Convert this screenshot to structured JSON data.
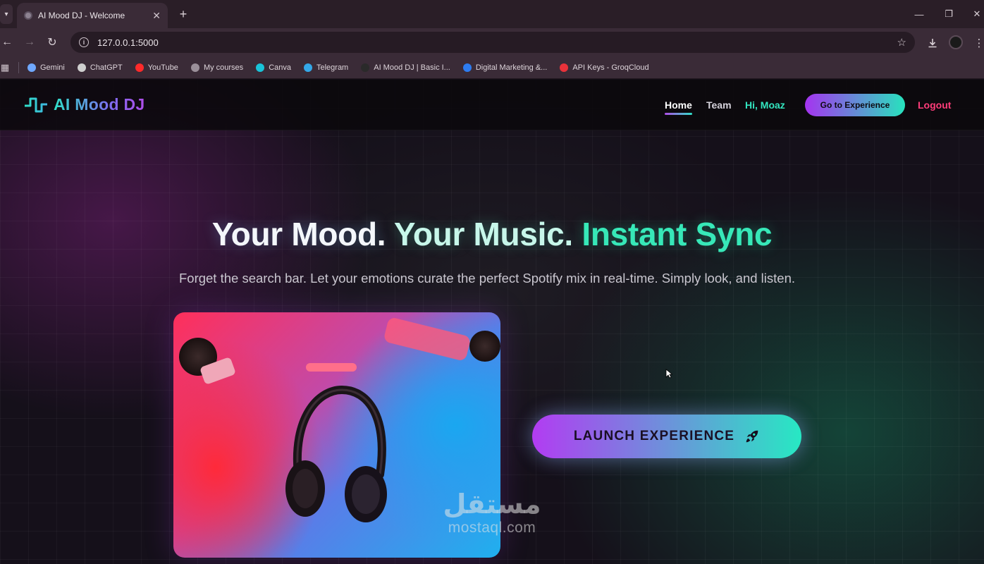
{
  "browser": {
    "tab_title": "AI Mood DJ - Welcome",
    "url": "127.0.0.1:5000",
    "bookmarks": [
      {
        "label": "Gemini",
        "color": "#6fa8ff"
      },
      {
        "label": "ChatGPT",
        "color": "#cfcfcf"
      },
      {
        "label": "YouTube",
        "color": "#ff2a2a"
      },
      {
        "label": "My courses",
        "color": "#9a8f99"
      },
      {
        "label": "Canva",
        "color": "#19c3d8"
      },
      {
        "label": "Telegram",
        "color": "#34a8e8"
      },
      {
        "label": "AI Mood DJ | Basic I...",
        "color": "#2a2a2a"
      },
      {
        "label": "Digital Marketing &...",
        "color": "#2d7cf0"
      },
      {
        "label": "API Keys - GroqCloud",
        "color": "#e8323a"
      }
    ]
  },
  "nav": {
    "brand": "AI Mood DJ",
    "home": "Home",
    "team": "Team",
    "greeting": "Hi, Moaz",
    "cta": "Go to Experience",
    "logout": "Logout"
  },
  "hero": {
    "headline_part1": "Your Mood.",
    "headline_part2": "Your Music.",
    "headline_part3": "Instant Sync",
    "subtitle": "Forget the search bar. Let your emotions curate the perfect Spotify mix in real-time. Simply look, and listen.",
    "launch_label": "LAUNCH EXPERIENCE"
  },
  "watermark": {
    "arabic": "مستقل",
    "site": "mostaql.com"
  },
  "colors": {
    "accent_purple": "#b23cf2",
    "accent_teal": "#27e8c3",
    "logout_red": "#ff3d7a",
    "greeting_teal": "#33e6c0"
  }
}
